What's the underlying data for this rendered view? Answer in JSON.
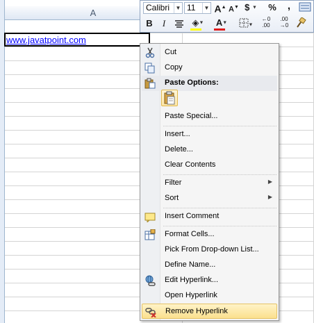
{
  "sheet": {
    "column_headers": [
      "A",
      ""
    ],
    "cell_a1": "www.javatpoint.com"
  },
  "mini_toolbar": {
    "font_name": "Calibri",
    "font_size": "11",
    "grow_font": "A",
    "shrink_font": "A",
    "currency": "$",
    "percent": "%",
    "comma": ",",
    "bold": "B",
    "italic": "I",
    "font_color": "A",
    "increase_decimal": ".00",
    "decrease_decimal": ".00",
    "colors": {
      "font_color_bar": "#e01b1b",
      "fill_color_bar": "#ffff00"
    }
  },
  "context_menu": {
    "items": [
      {
        "label": "Cut",
        "icon": "scissors-icon"
      },
      {
        "label": "Copy",
        "icon": "copy-icon"
      },
      {
        "label": "Paste Options:",
        "icon": "paste-icon"
      },
      {
        "label": "Paste Special...",
        "icon": ""
      },
      {
        "label": "Insert...",
        "icon": ""
      },
      {
        "label": "Delete...",
        "icon": ""
      },
      {
        "label": "Clear Contents",
        "icon": ""
      },
      {
        "label": "Filter",
        "icon": "",
        "submenu": true
      },
      {
        "label": "Sort",
        "icon": "",
        "submenu": true
      },
      {
        "label": "Insert Comment",
        "icon": "comment-icon"
      },
      {
        "label": "Format Cells...",
        "icon": "format-cells-icon"
      },
      {
        "label": "Pick From Drop-down List...",
        "icon": ""
      },
      {
        "label": "Define Name...",
        "icon": ""
      },
      {
        "label": "Edit Hyperlink...",
        "icon": "edit-hyperlink-icon"
      },
      {
        "label": "Open Hyperlink",
        "icon": ""
      },
      {
        "label": "Remove Hyperlink",
        "icon": "remove-hyperlink-icon",
        "highlighted": true
      }
    ]
  },
  "colors": {
    "highlight": "#fbe08e",
    "hyperlink": "#0000ff"
  }
}
